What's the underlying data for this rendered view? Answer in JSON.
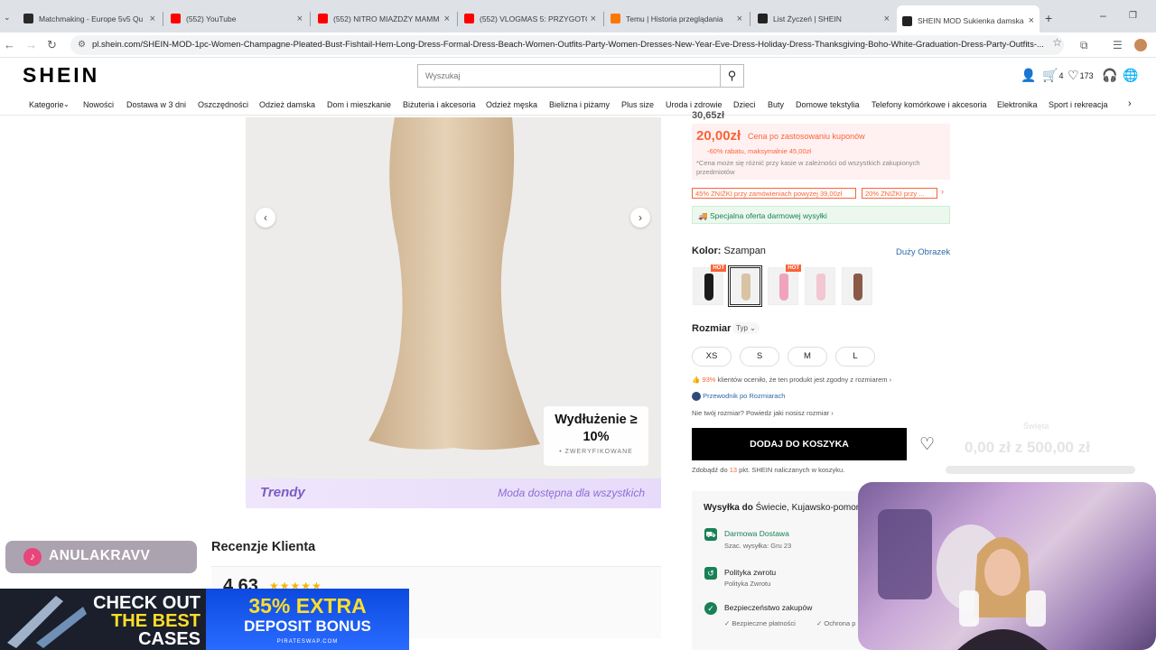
{
  "browser": {
    "tabs": [
      {
        "title": "Matchmaking - Europe 5v5 Qu",
        "color": "#2a2a2a"
      },
      {
        "title": "(552) YouTube",
        "color": "#ff0000"
      },
      {
        "title": "(552) NITRO MIAŻDŻY MAMM",
        "color": "#ff0000"
      },
      {
        "title": "(552) VLOGMAS 5: PRZYGOTO",
        "color": "#ff0000"
      },
      {
        "title": "Temu | Historia przeglądania",
        "color": "#fb7701"
      },
      {
        "title": "List Życzeń | SHEIN",
        "color": "#222222"
      },
      {
        "title": "SHEIN MOD Sukienka damska",
        "color": "#222222"
      }
    ],
    "url": "pl.shein.com/SHEIN-MOD-1pc-Women-Champagne-Pleated-Bust-Fishtail-Hem-Long-Dress-Formal-Dress-Beach-Women-Outfits-Party-Women-Dresses-New-Year-Eve-Dress-Holiday-Dress-Thanksgiving-Boho-White-Graduation-Dress-Party-Outfits-..."
  },
  "header": {
    "logo": "SHEIN",
    "search_placeholder": "Wyszukaj",
    "cart_count": "4",
    "wishlist_count": "173"
  },
  "categories": [
    "Kategorie",
    "Nowości",
    "Dostawa w 3 dni",
    "Oszczędności",
    "Odzież damska",
    "Dom i mieszkanie",
    "Biżuteria i akcesoria",
    "Odzież męska",
    "Bielizna i piżamy",
    "Plus size",
    "Uroda i zdrowie",
    "Dzieci",
    "Buty",
    "Domowe tekstylia",
    "Telefony komórkowe i akcesoria",
    "Elektronika",
    "Sport i rekreacja"
  ],
  "product": {
    "badge_line1": "Wydłużenie ≥",
    "badge_line2": "10%",
    "badge_line3": "• ZWERYFIKOWANE",
    "trendy_logo": "Trendy",
    "trendy_text": "Moda dostępna dla wszystkich",
    "reviews_title": "Recenzje Klienta",
    "rating": "4,63"
  },
  "panel": {
    "old_price": "30,65zł",
    "coupon_price": "20,00zł",
    "coupon_label": "Cena po zastosowaniu kuponów",
    "coupon_sub": "-60% rabatu, maksymalnie 45,00zł",
    "coupon_note": "*Cena może się różnić przy kasie w zależności od wszystkich zakupionych przedmiotów",
    "promo1": "45% ZNIŻKI przy zamówieniach powyżej 39,00zł",
    "promo2": "20% ZNIŻKI przy ...",
    "ship_offer": "Specjalna oferta darmowej wysyłki",
    "color_label": "Kolor:",
    "color_value": "Szampan",
    "big_image_link": "Duży Obrazek",
    "size_label": "Rozmiar",
    "size_type": "Typ",
    "sizes": [
      "XS",
      "S",
      "M",
      "L"
    ],
    "fit_pct": "93%",
    "fit_text": "klientów oceniło, że ten produkt jest zgodny z rozmiarem",
    "size_guide": "Przewodnik po Rozmiarach",
    "size_help": "Nie twój rozmiar? Powiedz jaki nosisz rozmiar",
    "add_to_cart": "DODAJ DO KOSZYKA",
    "points_prefix": "Zdobądź do",
    "points_num": "13",
    "points_suffix": "pkt. SHEIN naliczanych w koszyku.",
    "hot_label": "HOT",
    "swatch_colors": [
      "#1b1b1b",
      "#d8c3a4",
      "#efa3bd",
      "#f2c6d2",
      "#8a5a46"
    ]
  },
  "shipping": {
    "title_prefix": "Wysyłka do",
    "title_place": "Świecie, Kujawsko-pomorskie",
    "free": "Darmowa Dostawa",
    "est": "Szac. wysyłka: Gru 23",
    "return_title": "Polityka zwrotu",
    "return_sub": "Polityka Zwrotu",
    "safe_title": "Bezpieczeństwo zakupów",
    "safe1": "✓ Bezpieczne płatności",
    "safe2": "✓ Ochrona p"
  },
  "overlay": {
    "goal_label": "Święta",
    "goal_amount": "0,00 zł z 500,00 zł",
    "goal_progress": 0,
    "handle": "ANULAKRAVV",
    "ad_left1": "CHECK OUT",
    "ad_left2": "THE BEST",
    "ad_left3": "CASES",
    "ad_right1": "35% EXTRA",
    "ad_right2": "DEPOSIT BONUS",
    "ad_right3": "PIRATESWAP.COM"
  }
}
